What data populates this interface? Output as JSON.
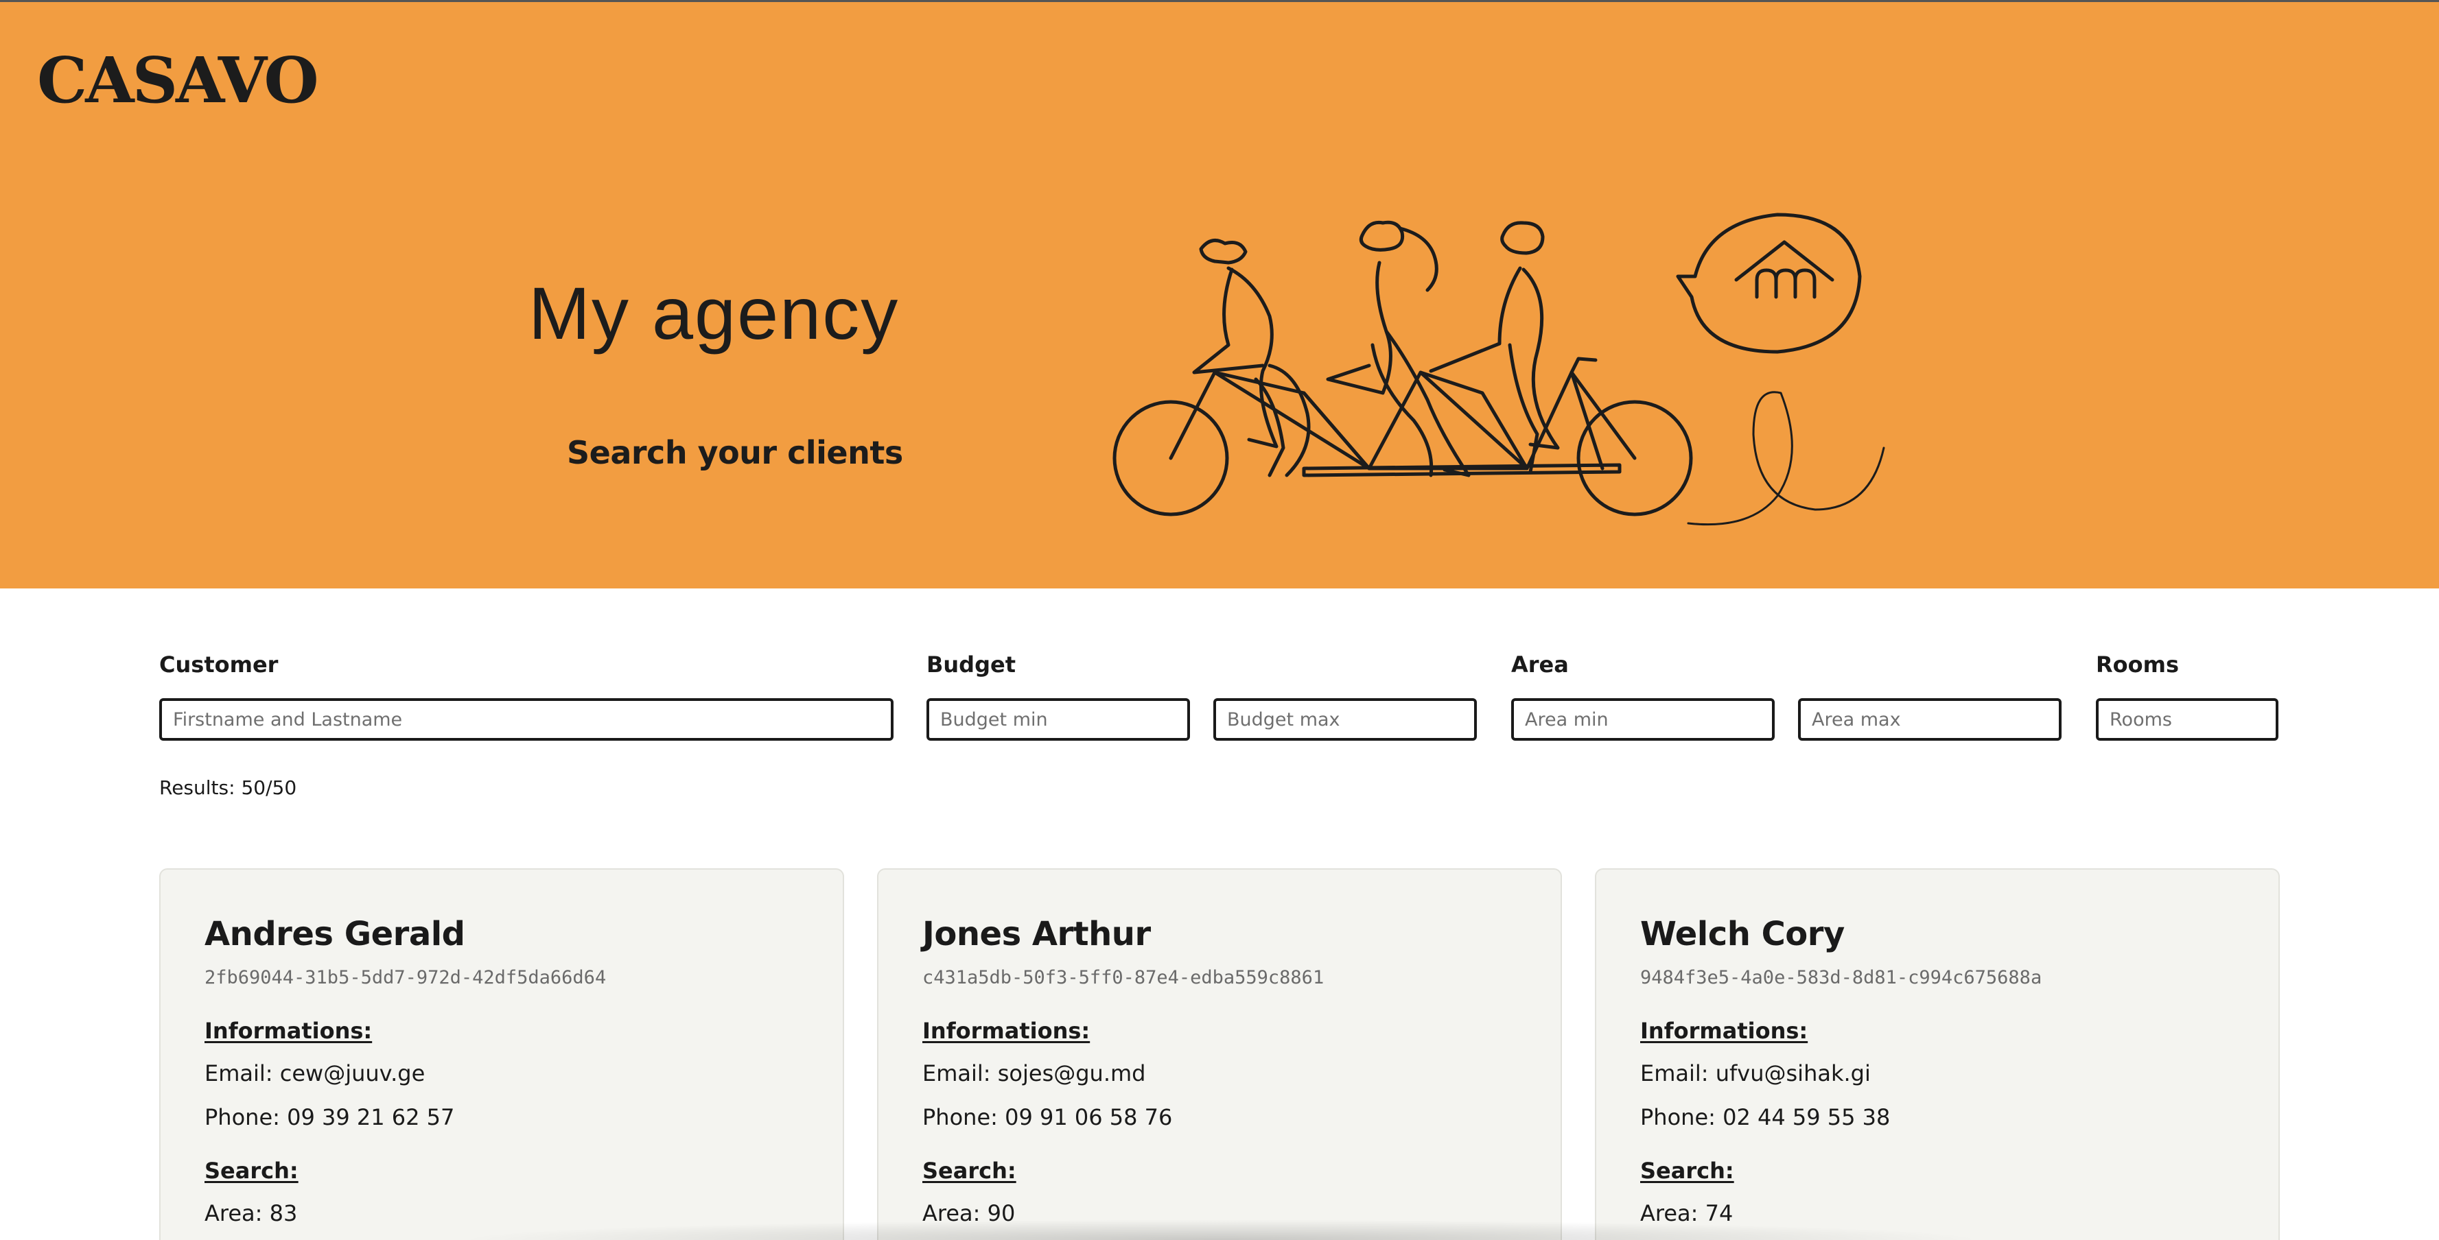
{
  "brand": {
    "logo_text": "CASAVO",
    "hero_color": "#f29d41"
  },
  "hero": {
    "title": "My agency",
    "subtitle": "Search your clients"
  },
  "filters": {
    "customer_label": "Customer",
    "customer_placeholder": "Firstname and Lastname",
    "budget_label": "Budget",
    "budget_min_placeholder": "Budget min",
    "budget_max_placeholder": "Budget max",
    "area_label": "Area",
    "area_min_placeholder": "Area min",
    "area_max_placeholder": "Area max",
    "rooms_label": "Rooms",
    "rooms_placeholder": "Rooms"
  },
  "results": {
    "text": "Results: 50/50"
  },
  "cards": [
    {
      "name": "Andres Gerald",
      "id": "2fb69044-31b5-5dd7-972d-42df5da66d64",
      "info_heading": "Informations:",
      "email": "Email: cew@juuv.ge",
      "phone": "Phone: 09 39 21 62 57",
      "search_heading": "Search:",
      "area": "Area: 83"
    },
    {
      "name": "Jones Arthur",
      "id": "c431a5db-50f3-5ff0-87e4-edba559c8861",
      "info_heading": "Informations:",
      "email": "Email: sojes@gu.md",
      "phone": "Phone: 09 91 06 58 76",
      "search_heading": "Search:",
      "area": "Area: 90"
    },
    {
      "name": "Welch Cory",
      "id": "9484f3e5-4a0e-583d-8d81-c994c675688a",
      "info_heading": "Informations:",
      "email": "Email: ufvu@sihak.gi",
      "phone": "Phone: 02 44 59 55 38",
      "search_heading": "Search:",
      "area": "Area: 74"
    }
  ]
}
